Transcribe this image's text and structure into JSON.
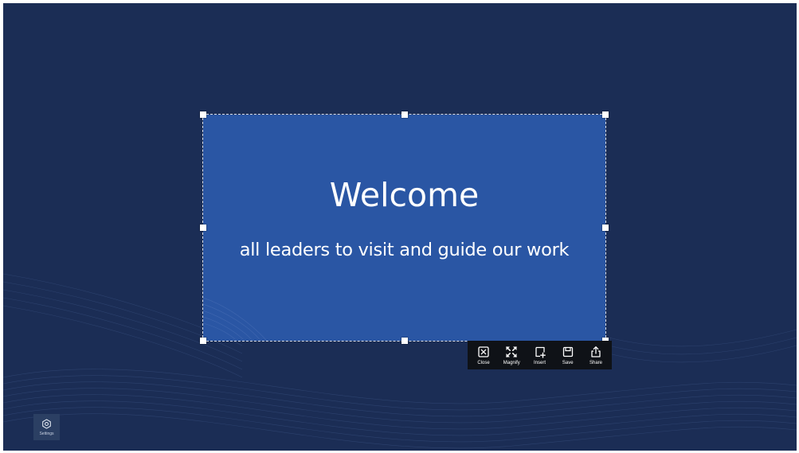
{
  "slide": {
    "title": "Welcome",
    "subtitle": "all leaders to visit and guide our work",
    "background_color": "#2a56a4"
  },
  "screen": {
    "background_color": "#1b2d55"
  },
  "toolbar": {
    "background_color": "#0f1217",
    "items": [
      {
        "label": "Close",
        "icon": "close-box-icon"
      },
      {
        "label": "Magnify",
        "icon": "magnify-expand-icon"
      },
      {
        "label": "Insert",
        "icon": "insert-note-icon"
      },
      {
        "label": "Save",
        "icon": "save-floppy-icon"
      },
      {
        "label": "Share",
        "icon": "share-export-icon"
      }
    ]
  },
  "settings": {
    "label": "Settings",
    "icon": "settings-gear-icon"
  }
}
